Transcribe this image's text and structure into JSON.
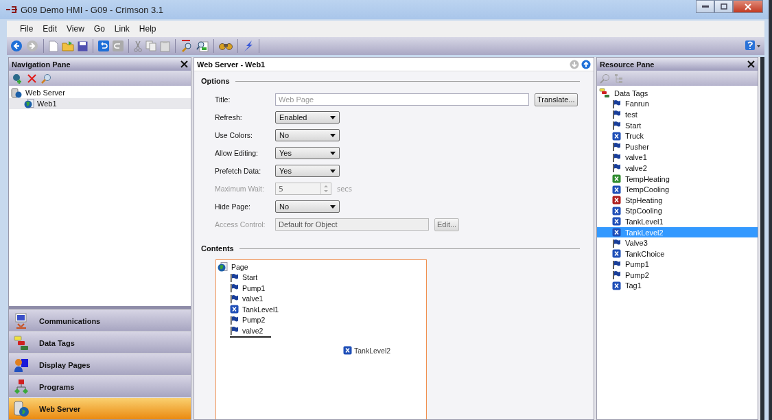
{
  "window": {
    "title": "G09 Demo HMI - G09 - Crimson 3.1"
  },
  "menu": [
    "File",
    "Edit",
    "View",
    "Go",
    "Link",
    "Help"
  ],
  "navigation_pane": {
    "title": "Navigation Pane",
    "tree": [
      {
        "label": "Web Server",
        "selected": false,
        "children": [
          {
            "label": "Web1",
            "selected": true
          }
        ]
      }
    ],
    "sections": [
      {
        "label": "Communications",
        "kind": "comms",
        "selected": false
      },
      {
        "label": "Data Tags",
        "kind": "tags",
        "selected": false
      },
      {
        "label": "Display Pages",
        "kind": "displays",
        "selected": false
      },
      {
        "label": "Programs",
        "kind": "programs",
        "selected": false
      },
      {
        "label": "Web Server",
        "kind": "web",
        "selected": true
      }
    ]
  },
  "editor": {
    "title": "Web Server - Web1",
    "options_heading": "Options",
    "options": [
      {
        "label": "Title:",
        "kind": "text",
        "placeholder": "Web Page",
        "button": "Translate...",
        "disabled": false
      },
      {
        "label": "Refresh:",
        "kind": "dropdown",
        "value": "Enabled",
        "disabled": false
      },
      {
        "label": "Use Colors:",
        "kind": "dropdown",
        "value": "No",
        "disabled": false
      },
      {
        "label": "Allow Editing:",
        "kind": "dropdown",
        "value": "Yes",
        "disabled": false
      },
      {
        "label": "Prefetch Data:",
        "kind": "dropdown",
        "value": "Yes",
        "disabled": false
      },
      {
        "label": "Maximum Wait:",
        "kind": "spin",
        "value": "5",
        "unit": "secs",
        "disabled": true
      },
      {
        "label": "Hide Page:",
        "kind": "dropdown",
        "value": "No",
        "disabled": false
      },
      {
        "label": "Access Control:",
        "kind": "readonly",
        "value": "Default for Object",
        "button": "Edit...",
        "disabled": true
      }
    ],
    "contents_heading": "Contents",
    "contents": {
      "label": "Page",
      "children": [
        {
          "label": "Start",
          "kind": "flag"
        },
        {
          "label": "Pump1",
          "kind": "flag"
        },
        {
          "label": "valve1",
          "kind": "flag"
        },
        {
          "label": "TankLevel1",
          "kind": "numeric"
        },
        {
          "label": "Pump2",
          "kind": "flag"
        },
        {
          "label": "valve2",
          "kind": "flag"
        }
      ]
    },
    "dragged_item": {
      "label": "TankLevel2",
      "kind": "numeric"
    }
  },
  "resource_pane": {
    "title": "Resource Pane",
    "tree": {
      "label": "Data Tags",
      "children": [
        {
          "label": "Fanrun",
          "kind": "flag",
          "color": "#1a3f9a",
          "selected": false
        },
        {
          "label": "test",
          "kind": "flag",
          "color": "#1a3f9a",
          "selected": false
        },
        {
          "label": "Start",
          "kind": "flag",
          "color": "#1a3f9a",
          "selected": false
        },
        {
          "label": "Truck",
          "kind": "numeric",
          "color": "#1f4fb8",
          "selected": false
        },
        {
          "label": "Pusher",
          "kind": "flag",
          "color": "#1a3f9a",
          "selected": false
        },
        {
          "label": "valve1",
          "kind": "flag",
          "color": "#1a3f9a",
          "selected": false
        },
        {
          "label": "valve2",
          "kind": "flag",
          "color": "#1a3f9a",
          "selected": false
        },
        {
          "label": "TempHeating",
          "kind": "numeric",
          "color": "#2e8b2e",
          "selected": false
        },
        {
          "label": "TempCooling",
          "kind": "numeric",
          "color": "#1f4fb8",
          "selected": false
        },
        {
          "label": "StpHeating",
          "kind": "numeric",
          "color": "#b02020",
          "selected": false
        },
        {
          "label": "StpCooling",
          "kind": "numeric",
          "color": "#1f4fb8",
          "selected": false
        },
        {
          "label": "TankLevel1",
          "kind": "numeric",
          "color": "#1f4fb8",
          "selected": false
        },
        {
          "label": "TankLevel2",
          "kind": "numeric",
          "color": "#1f4fb8",
          "selected": true
        },
        {
          "label": "Valve3",
          "kind": "flag",
          "color": "#1a3f9a",
          "selected": false
        },
        {
          "label": "TankChoice",
          "kind": "numeric",
          "color": "#1f4fb8",
          "selected": false
        },
        {
          "label": "Pump1",
          "kind": "flag",
          "color": "#1a3f9a",
          "selected": false
        },
        {
          "label": "Pump2",
          "kind": "flag",
          "color": "#1a3f9a",
          "selected": false
        },
        {
          "label": "Tag1",
          "kind": "numeric",
          "color": "#1f4fb8",
          "selected": false
        }
      ]
    }
  }
}
